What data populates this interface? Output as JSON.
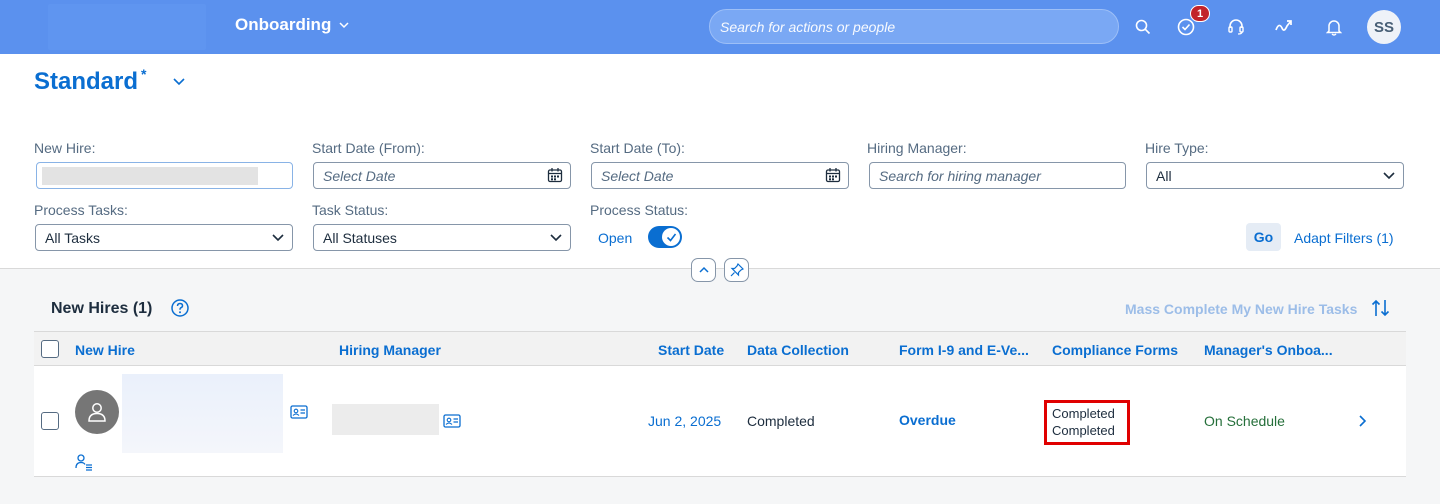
{
  "shell": {
    "app_title": "Onboarding",
    "search_placeholder": "Search for actions or people",
    "notification_badge": "1",
    "user_initials": "SS",
    "brand_color": "#5b91ee"
  },
  "variant": {
    "name": "Standard",
    "modified_marker": "*"
  },
  "filters": {
    "new_hire": {
      "label": "New Hire:",
      "value": ""
    },
    "start_from": {
      "label": "Start Date (From):",
      "placeholder": "Select Date"
    },
    "start_to": {
      "label": "Start Date (To):",
      "placeholder": "Select Date"
    },
    "hiring_manager": {
      "label": "Hiring Manager:",
      "placeholder": "Search for hiring manager"
    },
    "hire_type": {
      "label": "Hire Type:",
      "value": "All"
    },
    "process_tasks": {
      "label": "Process Tasks:",
      "value": "All Tasks"
    },
    "task_status": {
      "label": "Task Status:",
      "value": "All Statuses"
    },
    "process_status": {
      "label": "Process Status:",
      "switch_text": "Open",
      "switch_on": true
    }
  },
  "actions": {
    "go": "Go",
    "adapt_filters": "Adapt Filters (1)"
  },
  "table": {
    "title": "New Hires (1)",
    "mass_complete": "Mass Complete My New Hire Tasks",
    "columns": [
      "New Hire",
      "Hiring Manager",
      "Start Date",
      "Data Collection",
      "Form I-9 and E-Ve...",
      "Compliance Forms",
      "Manager's Onboa..."
    ],
    "rows": [
      {
        "new_hire": "",
        "hiring_manager": "",
        "start_date": "Jun 2, 2025",
        "data_collection": "Completed",
        "form_i9": "Overdue",
        "compliance_forms": [
          "Completed",
          "Completed"
        ],
        "managers_onboarding": "On Schedule"
      }
    ]
  }
}
